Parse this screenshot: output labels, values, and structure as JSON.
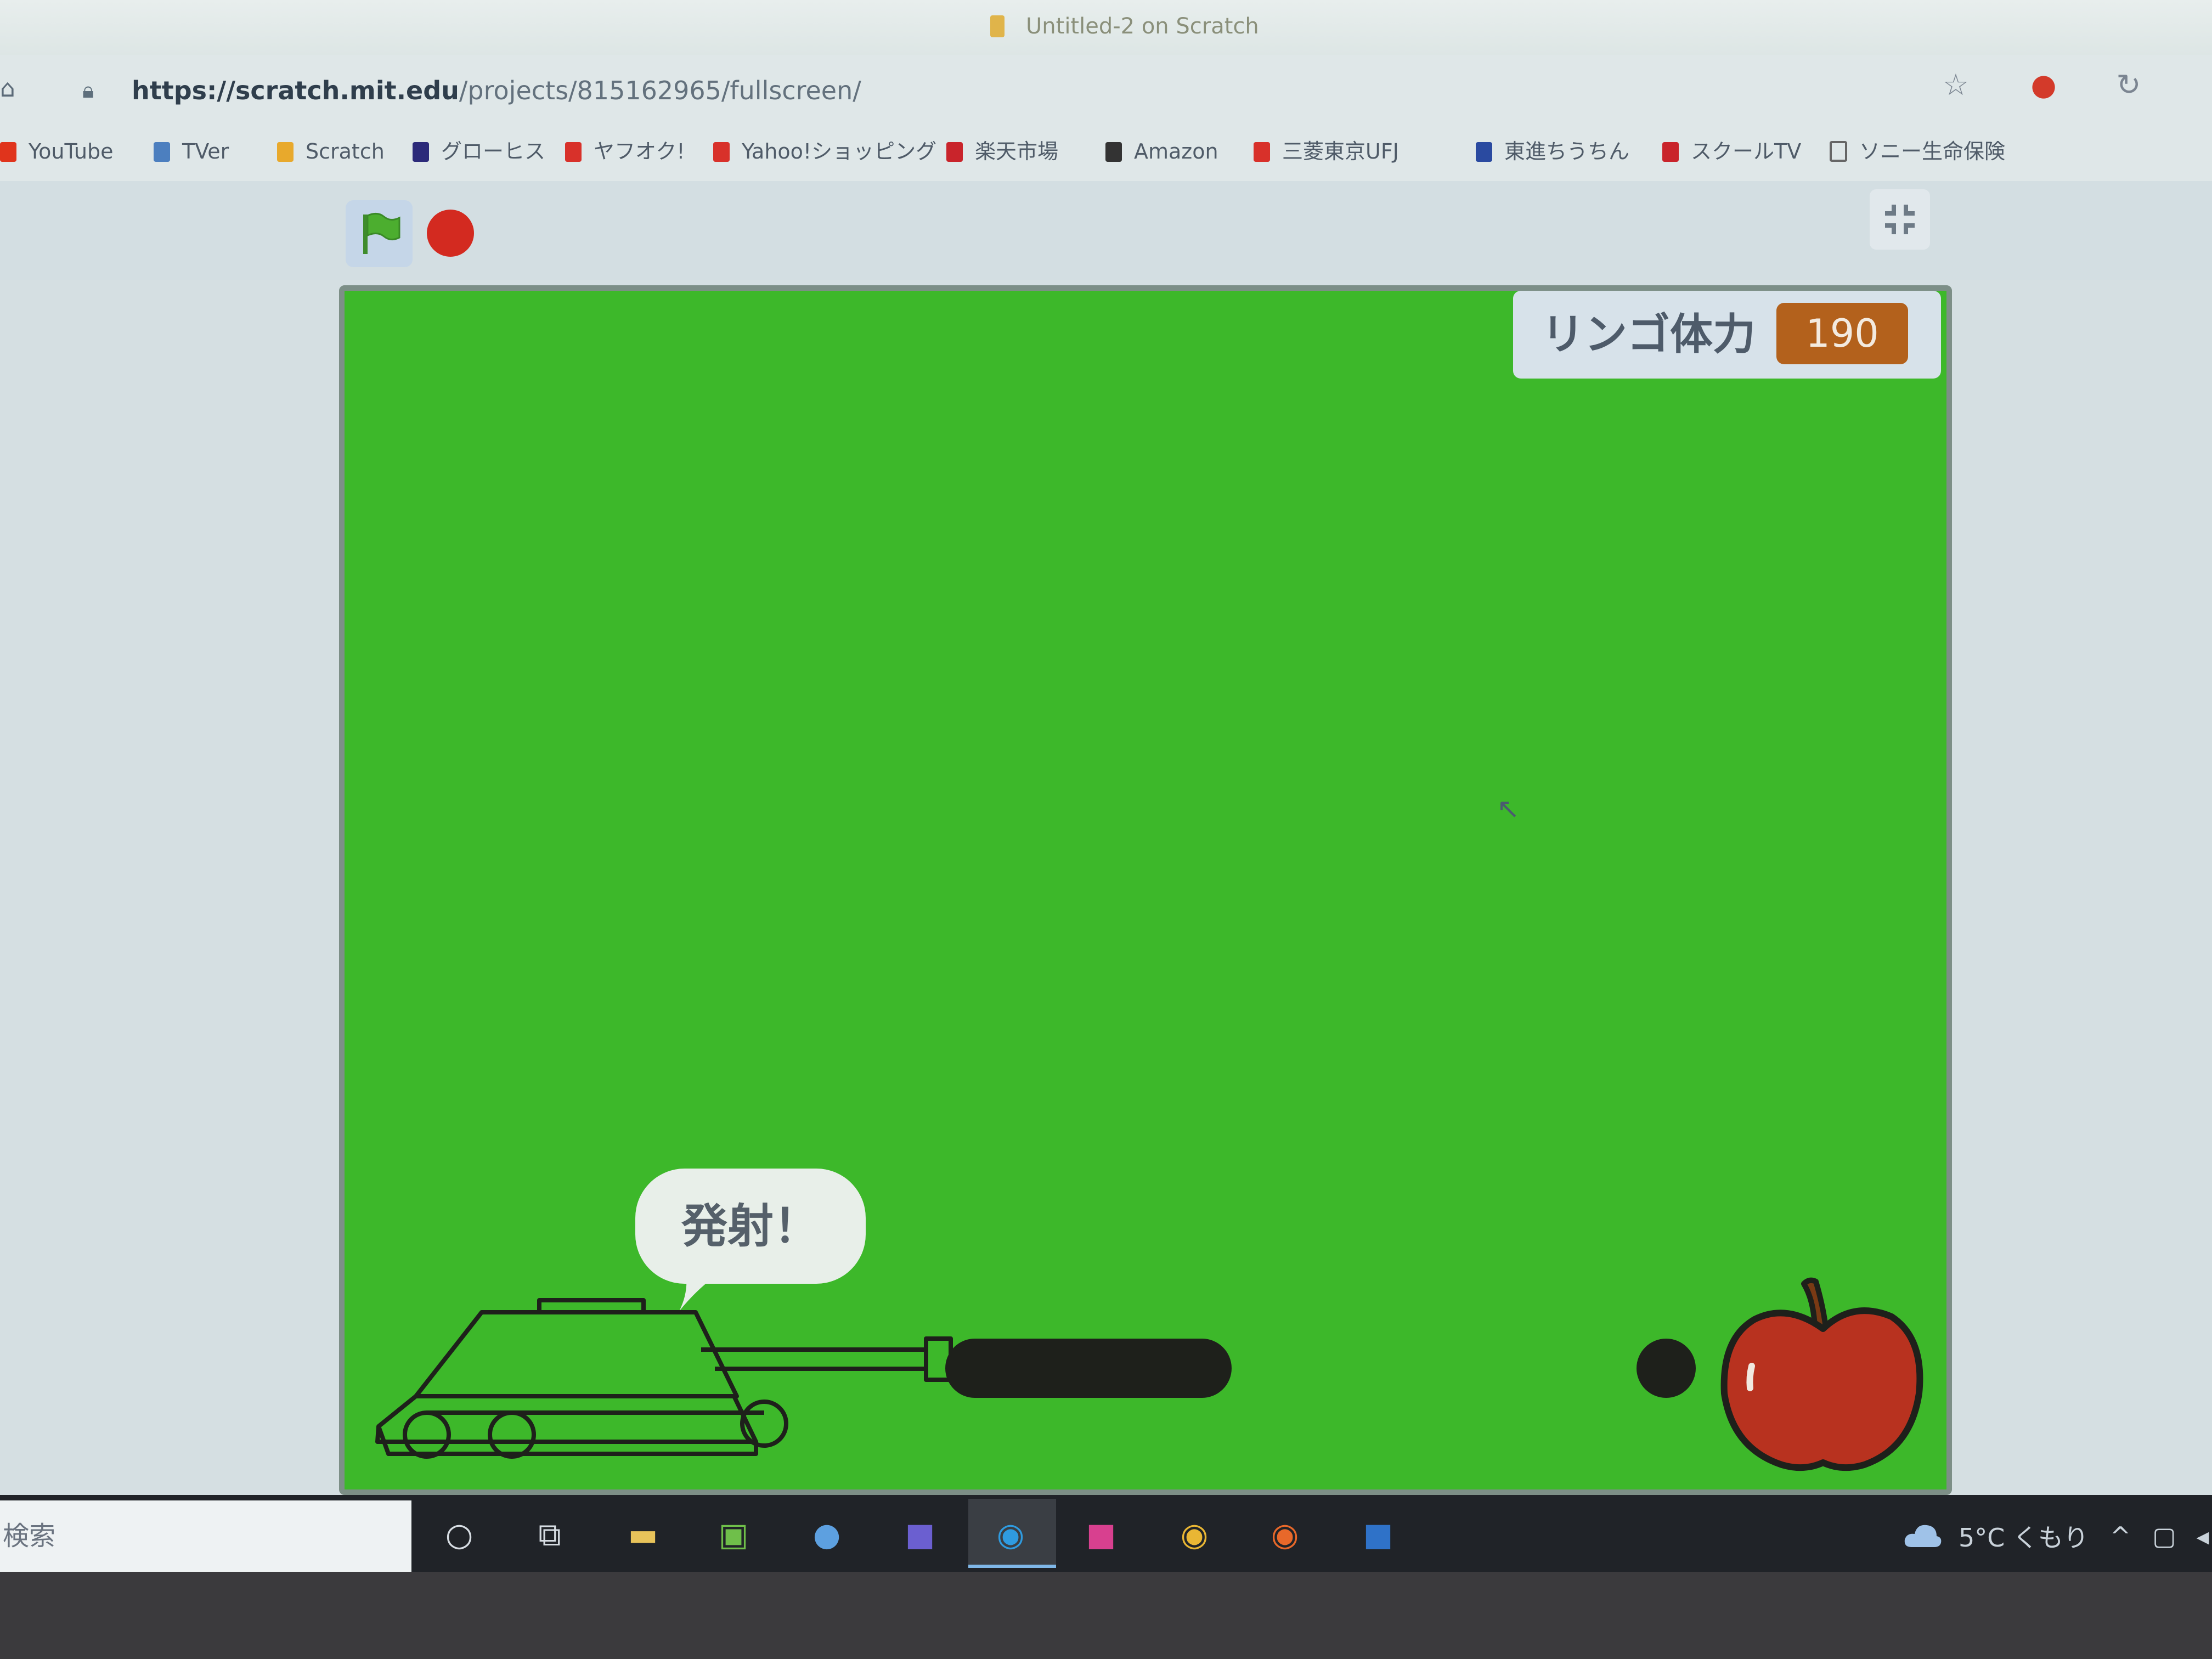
{
  "browser": {
    "window_title": "Untitled-2 on Scratch",
    "url_host": "https://scratch.mit.edu",
    "url_path": "/projects/815162965/fullscreen/",
    "bookmarks": [
      {
        "label": "YouTube",
        "icon": "youtube-icon",
        "color": "#e0341c"
      },
      {
        "label": "TVer",
        "icon": "tver-icon",
        "color": "#4c7fbf"
      },
      {
        "label": "Scratch",
        "icon": "scratch-icon",
        "color": "#e8a92c"
      },
      {
        "label": "グローヒス",
        "icon": "globis-icon",
        "color": "#2c2a7a"
      },
      {
        "label": "ヤフオク!",
        "icon": "yahoo-auction-icon",
        "color": "#d8312a"
      },
      {
        "label": "Yahoo!ショッピング",
        "icon": "yahoo-shopping-icon",
        "color": "#d8312a"
      },
      {
        "label": "楽天市場",
        "icon": "rakuten-icon",
        "color": "#c9242b"
      },
      {
        "label": "Amazon",
        "icon": "amazon-icon",
        "color": "#333333"
      },
      {
        "label": "三菱東京UFJ",
        "icon": "bank-icon",
        "color": "#d8312a"
      },
      {
        "label": "東進ちうちん",
        "icon": "toshin-icon",
        "color": "#2a4aa0"
      },
      {
        "label": "スクールTV",
        "icon": "schooltv-icon",
        "color": "#c9242b"
      },
      {
        "label": "ソニー生命保険",
        "icon": "page-icon",
        "color": "#666666"
      }
    ]
  },
  "scratch": {
    "variable_monitor": {
      "label": "リンゴ体力",
      "value": "190"
    },
    "speech_bubble": "発射！",
    "stage_color": "#3db82a"
  },
  "taskbar": {
    "search_placeholder": "検索",
    "weather": "5°C くもり"
  }
}
